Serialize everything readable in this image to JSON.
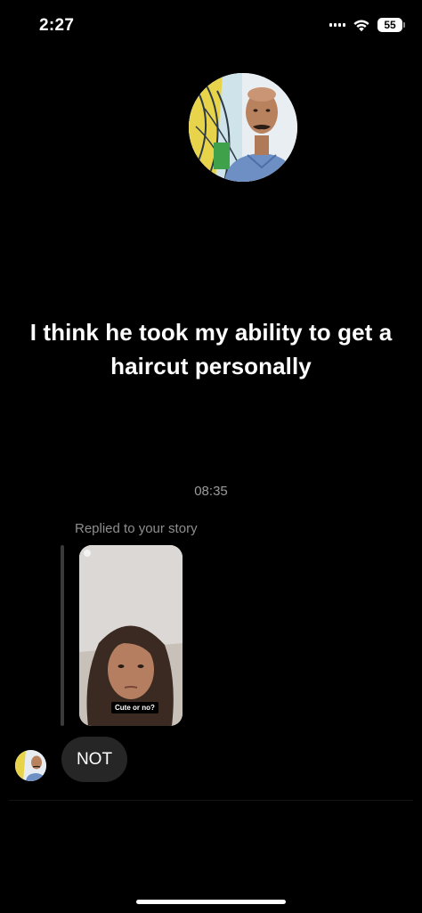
{
  "status_bar": {
    "time": "2:27",
    "battery_level": "55",
    "icons": [
      "cellular-signal-icon",
      "wifi-icon",
      "battery-icon"
    ]
  },
  "profile": {
    "avatar_icon": "profile-photo"
  },
  "story_caption": "I think he took my ability to get a haircut personally",
  "thread": {
    "timestamp": "08:35",
    "reply_label": "Replied to your story",
    "story_sticker_text": "Cute or no?",
    "message_text": "NOT"
  },
  "colors": {
    "background": "#000000",
    "bubble": "#262626",
    "muted_text": "#8e8e8e"
  }
}
